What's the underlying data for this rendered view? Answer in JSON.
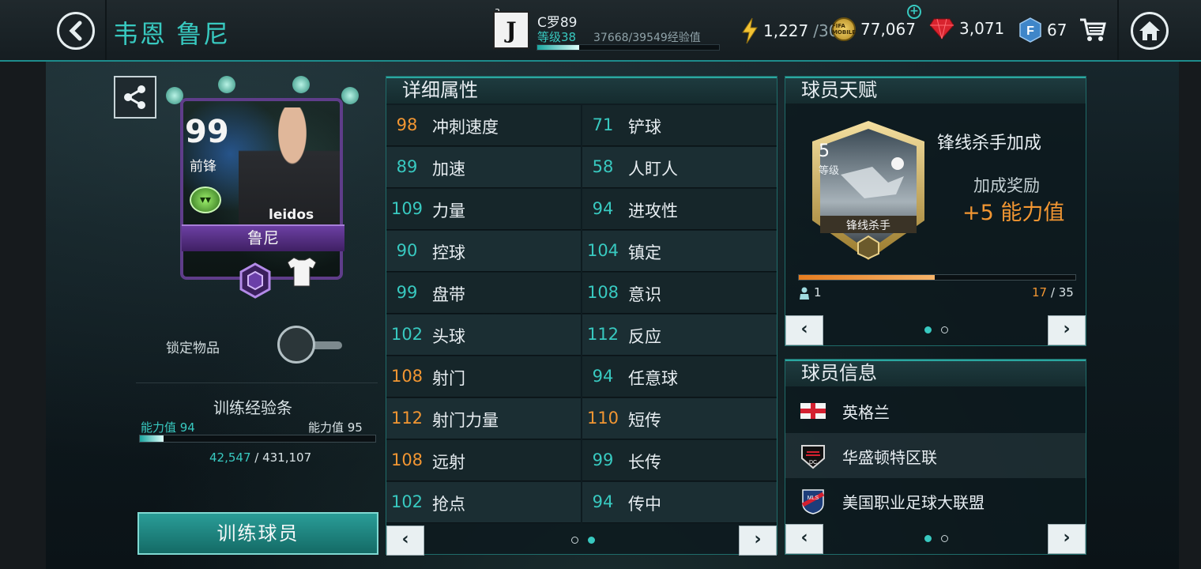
{
  "header": {
    "title": "韦恩 鲁尼",
    "club_number": "3",
    "user_name": "C罗89",
    "level_label": "等级38",
    "xp_text": "37668/39549经验值",
    "xp_fraction": 0.23
  },
  "resources": {
    "energy": "1,227",
    "energy_max": "/30",
    "coin_label": "FIFA MOBILE",
    "coins": "77,067",
    "gems": "3,071",
    "f_points": "67"
  },
  "card": {
    "rating": "99",
    "position": "前锋",
    "name": "鲁尼",
    "sponsor": "leidos"
  },
  "lock": {
    "label": "锁定物品",
    "on": false
  },
  "training": {
    "title": "训练经验条",
    "ability_current_label": "能力值 94",
    "ability_next_label": "能力值 95",
    "xp_current": "42,547",
    "xp_sep": " / ",
    "xp_total": "431,107",
    "fraction": 0.1,
    "button_label": "训练球员"
  },
  "attributes": {
    "title": "详细属性",
    "left": [
      {
        "value": "98",
        "name": "冲刺速度",
        "color": "orange"
      },
      {
        "value": "89",
        "name": "加速",
        "color": "teal"
      },
      {
        "value": "109",
        "name": "力量",
        "color": "teal"
      },
      {
        "value": "90",
        "name": "控球",
        "color": "teal"
      },
      {
        "value": "99",
        "name": "盘带",
        "color": "teal"
      },
      {
        "value": "102",
        "name": "头球",
        "color": "teal"
      },
      {
        "value": "108",
        "name": "射门",
        "color": "orange"
      },
      {
        "value": "112",
        "name": "射门力量",
        "color": "orange"
      },
      {
        "value": "108",
        "name": "远射",
        "color": "orange"
      },
      {
        "value": "102",
        "name": "抢点",
        "color": "teal"
      }
    ],
    "right": [
      {
        "value": "71",
        "name": "铲球",
        "color": "teal"
      },
      {
        "value": "58",
        "name": "人盯人",
        "color": "teal"
      },
      {
        "value": "94",
        "name": "进攻性",
        "color": "teal"
      },
      {
        "value": "104",
        "name": "镇定",
        "color": "teal"
      },
      {
        "value": "108",
        "name": "意识",
        "color": "teal"
      },
      {
        "value": "112",
        "name": "反应",
        "color": "teal"
      },
      {
        "value": "94",
        "name": "任意球",
        "color": "teal"
      },
      {
        "value": "110",
        "name": "短传",
        "color": "orange"
      },
      {
        "value": "99",
        "name": "长传",
        "color": "teal"
      },
      {
        "value": "94",
        "name": "传中",
        "color": "teal"
      }
    ],
    "page": 2,
    "pages": 2
  },
  "talent": {
    "title": "球员天赋",
    "level_num": "5",
    "level_word": "等级",
    "card_label": "锋线杀手",
    "name": "锋线杀手加成",
    "bonus_label": "加成奖励",
    "bonus_value": "+5 能力值",
    "count": "1",
    "progress_current": "17",
    "progress_sep": " / ",
    "progress_total": "35",
    "progress_fraction": 0.49,
    "page": 1,
    "pages": 2
  },
  "info": {
    "title": "球员信息",
    "items": [
      {
        "text": "英格兰",
        "icon": "england-flag-icon"
      },
      {
        "text": "华盛顿特区联",
        "icon": "dc-united-icon"
      },
      {
        "text": "美国职业足球大联盟",
        "icon": "mls-icon"
      }
    ],
    "page": 1,
    "pages": 2
  },
  "nav": {
    "prev": "‹",
    "next": "›"
  },
  "colors": {
    "accent": "#38c9c0",
    "highlight": "#f29632",
    "card_purple": "#5f3d8a"
  }
}
